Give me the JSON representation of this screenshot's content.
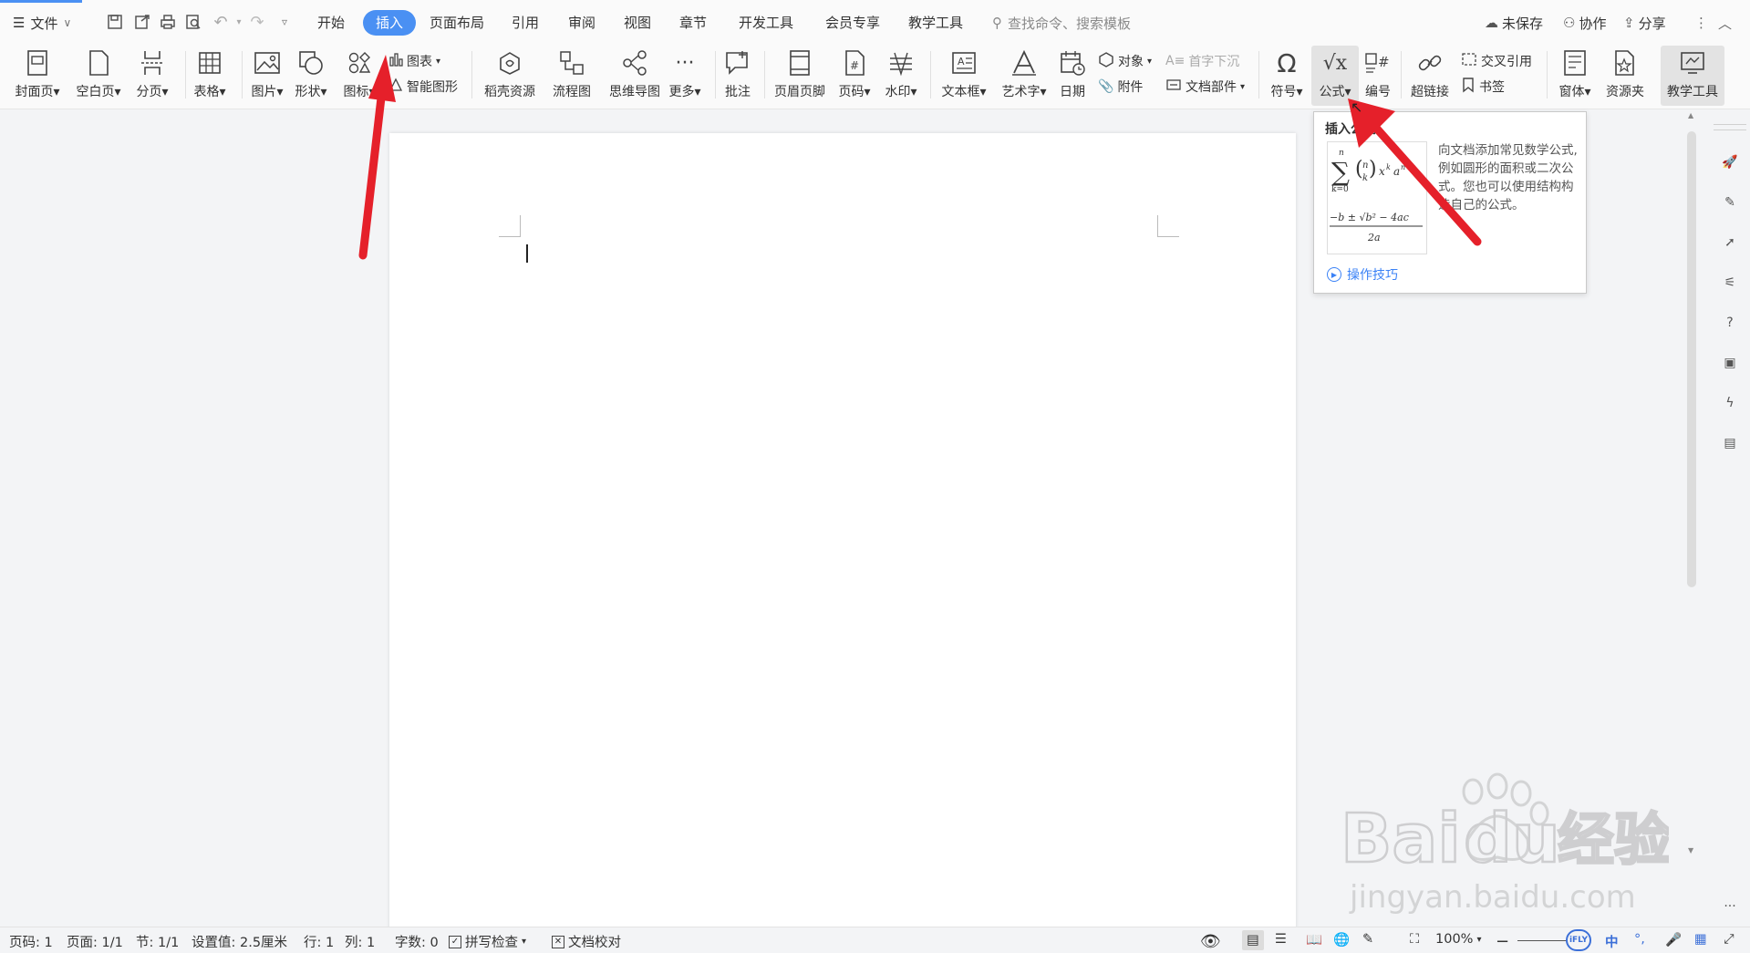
{
  "menubar": {
    "file_label": "文件",
    "tabs": [
      {
        "label": "开始",
        "active": false
      },
      {
        "label": "插入",
        "active": true
      },
      {
        "label": "页面布局",
        "active": false
      },
      {
        "label": "引用",
        "active": false
      },
      {
        "label": "审阅",
        "active": false
      },
      {
        "label": "视图",
        "active": false
      },
      {
        "label": "章节",
        "active": false
      },
      {
        "label": "开发工具",
        "active": false
      },
      {
        "label": "会员专享",
        "active": false
      },
      {
        "label": "教学工具",
        "active": false
      }
    ],
    "search_placeholder": "查找命令、搜索模板",
    "unsaved": "未保存",
    "collab": "协作",
    "share": "分享"
  },
  "ribbon": {
    "cover": "封面页",
    "blank": "空白页",
    "pagebreak": "分页",
    "table": "表格",
    "picture": "图片",
    "shape": "形状",
    "icon": "图标",
    "chart": "图表",
    "smartart": "智能图形",
    "docer": "稻壳资源",
    "flowchart": "流程图",
    "mindmap": "思维导图",
    "more": "更多",
    "comment": "批注",
    "header_footer": "页眉页脚",
    "page_number": "页码",
    "watermark": "水印",
    "textbox": "文本框",
    "wordart": "艺术字",
    "date": "日期",
    "object": "对象",
    "attachment": "附件",
    "dropcap": "首字下沉",
    "docparts": "文档部件",
    "symbol": "符号",
    "formula": "公式",
    "numbering": "编号",
    "hyperlink": "超链接",
    "crossref": "交叉引用",
    "bookmark": "书签",
    "window": "窗体",
    "resource": "资源夹",
    "teaching": "教学工具"
  },
  "tooltip": {
    "title": "插入公式",
    "description": "向文档添加常见数学公式, 例如圆形的面积或二次公式。您也可以使用结构构造自己的公式。",
    "link": "操作技巧"
  },
  "statusbar": {
    "page_num": "页码: 1",
    "pages": "页面: 1/1",
    "section": "节: 1/1",
    "setting": "设置值: 2.5厘米",
    "row": "行: 1",
    "col": "列: 1",
    "words": "字数: 0",
    "spell": "拼写检查",
    "proof": "文档校对",
    "zoom": "100%",
    "ime": "中"
  },
  "watermark": {
    "brand": "Baidu经验",
    "url": "jingyan.baidu.com"
  },
  "colors": {
    "accent": "#4a90f3",
    "arrow": "#e5202a"
  }
}
